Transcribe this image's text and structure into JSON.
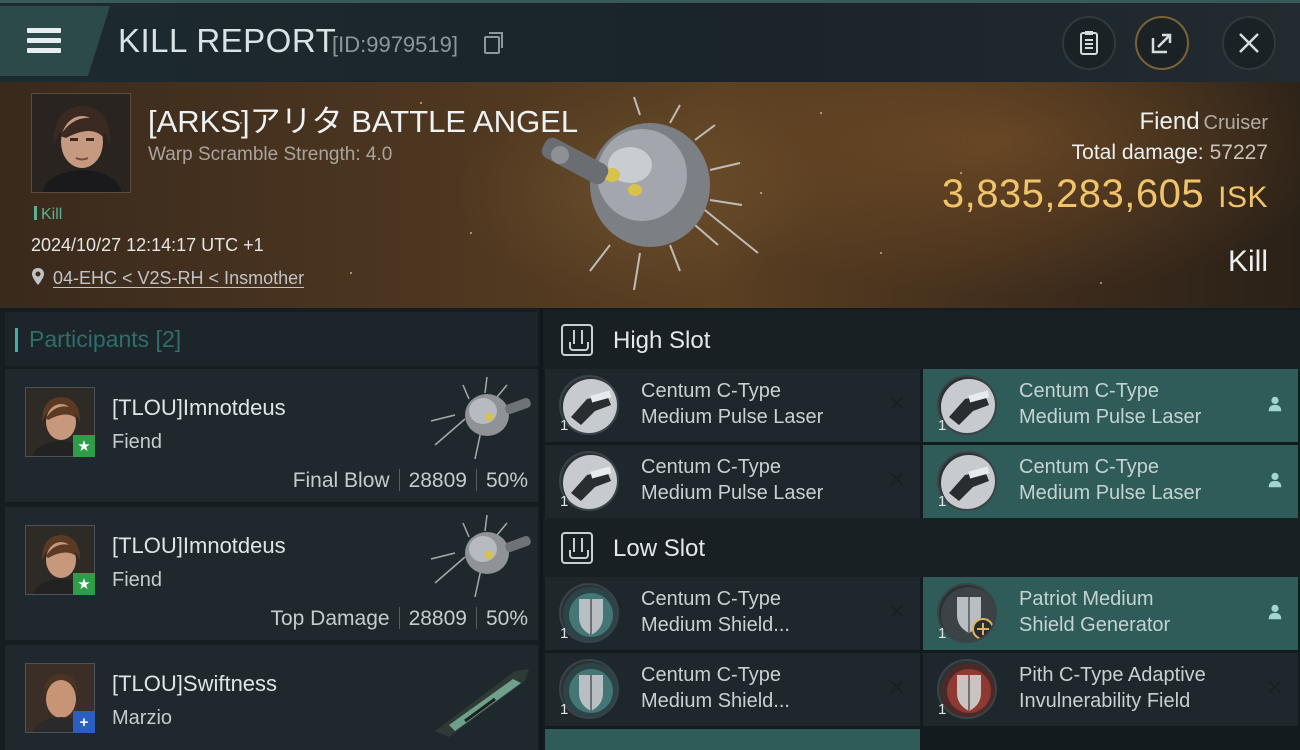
{
  "header": {
    "title": "KILL REPORT",
    "kill_id": "[ID:9979519]"
  },
  "victim": {
    "name": "[ARKS]アリタ BATTLE ANGEL",
    "warp_scramble": "Warp Scramble Strength: 4.0",
    "tag": "Kill",
    "datetime": "2024/10/27 12:14:17 UTC +1",
    "location": "04-EHC < V2S-RH < Insmother",
    "ship": "Fiend",
    "ship_class": "Cruiser",
    "total_damage_label": "Total damage:",
    "total_damage": "57227",
    "isk_value": "3,835,283,605",
    "isk_unit": "ISK",
    "result": "Kill"
  },
  "participants": {
    "header": "Participants [2]",
    "rows": [
      {
        "name": "[TLOU]Imnotdeus",
        "ship": "Fiend",
        "role": "Final Blow",
        "damage": "28809",
        "percent": "50%",
        "badge": "★",
        "badge_color": "#2e9d4a"
      },
      {
        "name": "[TLOU]Imnotdeus",
        "ship": "Fiend",
        "role": "Top Damage",
        "damage": "28809",
        "percent": "50%",
        "badge": "★",
        "badge_color": "#2e9d4a"
      },
      {
        "name": "[TLOU]Swiftness",
        "ship": "Marzio",
        "role": "",
        "damage": "",
        "percent": "",
        "badge": "+",
        "badge_color": "#2a5fc0"
      }
    ]
  },
  "slots": {
    "high": {
      "label": "High Slot",
      "modules": [
        {
          "line1": "Centum C-Type",
          "line2": "Medium Pulse Laser",
          "qty": "1",
          "state": "destroyed"
        },
        {
          "line1": "Centum C-Type",
          "line2": "Medium Pulse Laser",
          "qty": "1",
          "state": "dropped"
        },
        {
          "line1": "Centum C-Type",
          "line2": "Medium Pulse Laser",
          "qty": "1",
          "state": "destroyed"
        },
        {
          "line1": "Centum C-Type",
          "line2": "Medium Pulse Laser",
          "qty": "1",
          "state": "dropped"
        }
      ]
    },
    "low": {
      "label": "Low Slot",
      "modules": [
        {
          "line1": "Centum C-Type",
          "line2": "Medium Shield...",
          "qty": "1",
          "state": "destroyed"
        },
        {
          "line1": "Patriot Medium",
          "line2": "Shield Generator",
          "qty": "1",
          "state": "dropped"
        },
        {
          "line1": "Centum C-Type",
          "line2": "Medium Shield...",
          "qty": "1",
          "state": "destroyed"
        },
        {
          "line1": "Pith C-Type Adaptive",
          "line2": "Invulnerability Field",
          "qty": "1",
          "state": "destroyed"
        }
      ]
    }
  },
  "colors": {
    "accent": "#3fb0a6",
    "isk": "#f0c46a",
    "kill_tag": "#58b394",
    "fitted_row": "#2f5c58"
  }
}
